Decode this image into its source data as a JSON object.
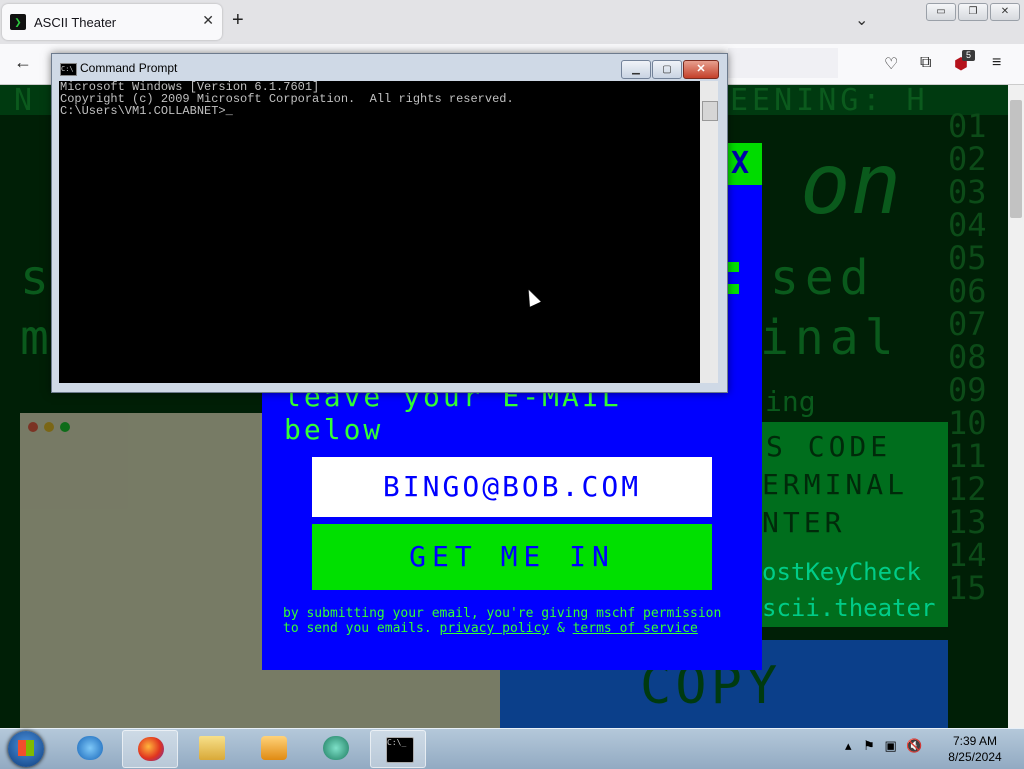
{
  "browser": {
    "tab_title": "ASCII Theater",
    "tab_close": "✕",
    "new_tab": "+",
    "tab_list": "⌄",
    "extension_badge": "5",
    "back": "←"
  },
  "page": {
    "header_fragment_left": "N",
    "header_fragment_right": "EENING: H",
    "side_numbers": [
      "01",
      "02",
      "03",
      "04",
      "05",
      "06",
      "07",
      "08",
      "09",
      "10",
      "11",
      "12",
      "13",
      "14",
      "15"
    ],
    "word_on": "on",
    "word_sed": "sed",
    "word_inal": "inal",
    "word_s": "s",
    "word_m": "m",
    "word_ing": "ing",
    "panel_line1": "S CODE",
    "panel_line2": "ERMINAL",
    "panel_line3": "NTER",
    "panel_line4": "ostKeyCheck",
    "panel_line5": "scii.theater",
    "copy_label": "COPY"
  },
  "popup": {
    "close_label": "X",
    "title_line1": "leave your E-MAIL",
    "title_line2": "below",
    "email_value": "BINGO@BOB.COM",
    "submit_label": "GET ME IN",
    "disclaimer_text": "by submitting your email, you're giving mschf permission to send you emails.",
    "privacy_link": "privacy policy",
    "amp": "&",
    "terms_link": "terms of service"
  },
  "cmd": {
    "title": "Command Prompt",
    "line1": "Microsoft Windows [Version 6.1.7601]",
    "line2": "Copyright (c) 2009 Microsoft Corporation.  All rights reserved.",
    "line3": "",
    "line4": "C:\\Users\\VM1.COLLABNET>_"
  },
  "taskbar": {
    "time": "7:39 AM",
    "date": "8/25/2024"
  }
}
